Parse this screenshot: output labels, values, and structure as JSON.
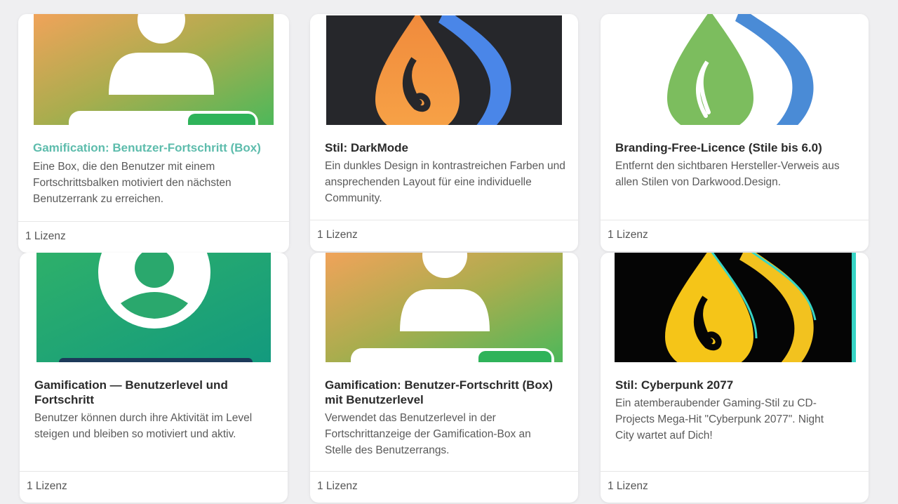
{
  "products": [
    {
      "title": "Gamification: Benutzer-Fortschritt (Box)",
      "description": "Eine Box, die den Benutzer mit einem Fortschrittsbalken motiviert den nächsten Benutzerrank zu erreichen.",
      "license": "1 Lizenz",
      "icon": "user-progress-icon"
    },
    {
      "title": "Stil: DarkMode",
      "description": "Ein dunkles Design in kontrastreichen Farben und ansprechenden Layout für eine individuelle Community.",
      "license": "1 Lizenz",
      "icon": "flame-logo-icon"
    },
    {
      "title": "Branding-Free-Licence (Stile bis 6.0)",
      "description": "Entfernt den sichtbaren Hersteller-Verweis aus allen Stilen von Darkwood.Design.",
      "license": "1 Lizenz",
      "icon": "flame-logo-icon"
    },
    {
      "title": "Gamification — Benutzerlevel und Fortschritt",
      "description": "Benutzer können durch ihre Aktivität im Level steigen und bleiben so motiviert und aktiv.",
      "license": "1 Lizenz",
      "icon": "user-circle-icon"
    },
    {
      "title": "Gamification: Benutzer-Fortschritt (Box) mit Benutzerlevel",
      "description": "Verwendet das Benutzerlevel in der Fortschrittanzeige der Gamification-Box an Stelle des Benutzerrangs.",
      "license": "1 Lizenz",
      "icon": "user-progress-icon"
    },
    {
      "title": "Stil: Cyberpunk 2077",
      "description": "Ein atemberaubender Gaming-Stil zu CD-Projects Mega-Hit \"Cyberpunk 2077\". Night City wartet auf Dich!",
      "license": "1 Lizenz",
      "icon": "flame-logo-icon"
    }
  ],
  "colors": {
    "title_highlight": "#5dbcac",
    "card_bg": "#ffffff",
    "page_bg": "#efeff1"
  }
}
